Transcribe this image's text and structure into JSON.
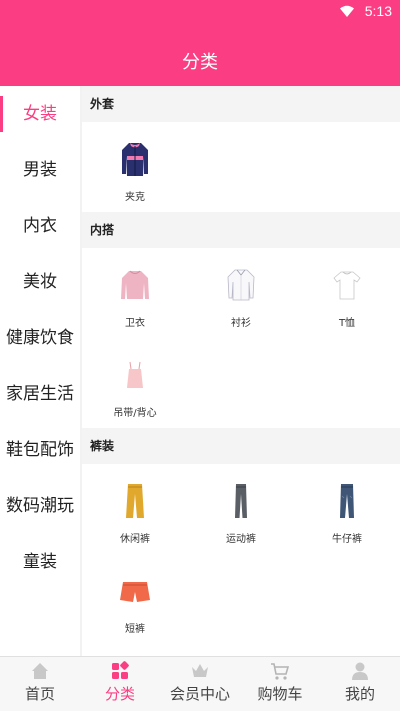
{
  "status": {
    "time": "5:13"
  },
  "header": {
    "title": "分类"
  },
  "sidebar": {
    "items": [
      {
        "label": "女装",
        "active": true
      },
      {
        "label": "男装"
      },
      {
        "label": "内衣"
      },
      {
        "label": "美妆"
      },
      {
        "label": "健康饮食"
      },
      {
        "label": "家居生活"
      },
      {
        "label": "鞋包配饰"
      },
      {
        "label": "数码潮玩"
      },
      {
        "label": "童装"
      }
    ]
  },
  "sections": [
    {
      "title": "外套",
      "items": [
        {
          "label": "夹克",
          "icon": "jacket-icon"
        }
      ]
    },
    {
      "title": "内搭",
      "items": [
        {
          "label": "卫衣",
          "icon": "hoodie-icon"
        },
        {
          "label": "衬衫",
          "icon": "shirt-icon"
        },
        {
          "label": "T恤",
          "icon": "tshirt-icon"
        },
        {
          "label": "吊带/背心",
          "icon": "camisole-icon"
        }
      ]
    },
    {
      "title": "裤装",
      "items": [
        {
          "label": "休闲裤",
          "icon": "casual-pants-icon"
        },
        {
          "label": "运动裤",
          "icon": "sweatpants-icon"
        },
        {
          "label": "牛仔裤",
          "icon": "jeans-icon"
        },
        {
          "label": "短裤",
          "icon": "shorts-icon"
        }
      ]
    }
  ],
  "tabbar": {
    "tabs": [
      {
        "label": "首页",
        "icon": "home-icon"
      },
      {
        "label": "分类",
        "icon": "category-icon",
        "active": true
      },
      {
        "label": "会员中心",
        "icon": "crown-icon"
      },
      {
        "label": "购物车",
        "icon": "cart-icon"
      },
      {
        "label": "我的",
        "icon": "user-icon"
      }
    ]
  },
  "colors": {
    "accent": "#fb3e83",
    "inactive_icon": "#c8c8c8"
  }
}
